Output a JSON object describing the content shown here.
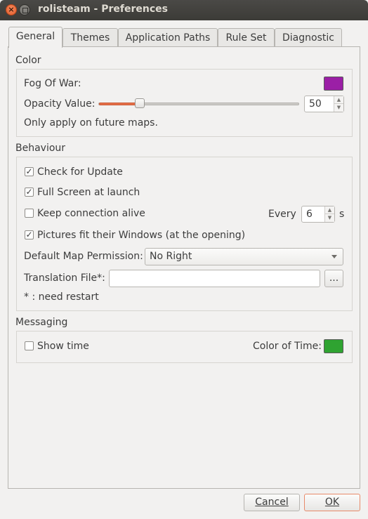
{
  "window": {
    "title": "rolisteam - Preferences"
  },
  "tabs": [
    "General",
    "Themes",
    "Application Paths",
    "Rule Set",
    "Diagnostic"
  ],
  "color_section": {
    "title": "Color",
    "fog_label": "Fog Of War:",
    "fog_color": "#9b1fa6",
    "opacity_label": "Opacity Value:",
    "opacity_value": "50",
    "opacity_fraction": 0.2,
    "note": "Only apply on future maps."
  },
  "behaviour_section": {
    "title": "Behaviour",
    "check_update": {
      "label": "Check for Update",
      "checked": true
    },
    "fullscreen": {
      "label": "Full Screen at launch",
      "checked": true
    },
    "keep_alive": {
      "label": "Keep connection alive",
      "checked": false
    },
    "every_label": "Every",
    "every_value": "6",
    "every_unit": "s",
    "pictures_fit": {
      "label": "Pictures fit their Windows (at the opening)",
      "checked": true
    },
    "map_permission_label": "Default Map Permission:",
    "map_permission_value": "No Right",
    "translation_label": "Translation File*:",
    "translation_value": "",
    "browse_label": "...",
    "restart_note": "* : need restart"
  },
  "messaging_section": {
    "title": "Messaging",
    "show_time": {
      "label": "Show time",
      "checked": false
    },
    "color_time_label": "Color of Time:",
    "color_time": "#2fa331"
  },
  "buttons": {
    "cancel": "Cancel",
    "ok": "OK"
  }
}
